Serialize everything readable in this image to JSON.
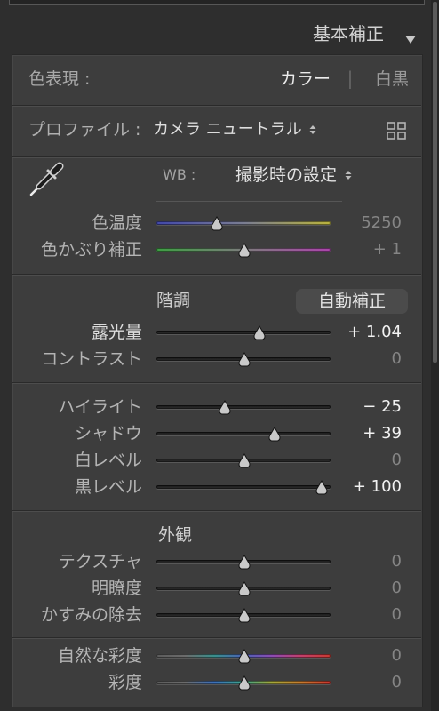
{
  "panel": {
    "title": "基本補正"
  },
  "icons": {
    "collapse": "collapse-triangle-icon",
    "eyedropper": "eyedropper-icon",
    "dropdown": "updown-arrows-icon",
    "profile_browser": "grid-icon"
  },
  "treatment": {
    "label": "色表現 :",
    "options": [
      {
        "label": "カラー",
        "selected": true
      },
      {
        "label": "白黒",
        "selected": false
      }
    ],
    "separator": "|"
  },
  "profile": {
    "label": "プロファイル :",
    "value": "カメラ ニュートラル"
  },
  "white_balance": {
    "label": "WB :",
    "value": "撮影時の設定",
    "sliders": [
      {
        "label": "色温度",
        "value": "5250",
        "level": 0.32,
        "track_colors": [
          "#4248aa",
          "#7a7d92",
          "#bab33e"
        ]
      },
      {
        "label": "色かぶり補正",
        "value": "+ 1",
        "level": 0.5,
        "track_colors": [
          "#3f9e44",
          "#7c7c7c",
          "#ab45ab"
        ]
      }
    ]
  },
  "tone": {
    "heading": "階調",
    "auto_button": "自動補正",
    "sliders": [
      {
        "label": "露光量",
        "value": "+ 1.04",
        "level": 0.6
      },
      {
        "label": "コントラスト",
        "value": "0",
        "level": 0.5
      },
      {
        "label": "ハイライト",
        "value": "− 25",
        "level": 0.375
      },
      {
        "label": "シャドウ",
        "value": "+ 39",
        "level": 0.695
      },
      {
        "label": "白レベル",
        "value": "0",
        "level": 0.5
      },
      {
        "label": "黒レベル",
        "value": "+ 100",
        "level": 1.0
      }
    ]
  },
  "presence": {
    "heading": "外観",
    "sliders": [
      {
        "label": "テクスチャ",
        "value": "0",
        "level": 0.5
      },
      {
        "label": "明瞭度",
        "value": "0",
        "level": 0.5
      },
      {
        "label": "かすみの除去",
        "value": "0",
        "level": 0.5
      },
      {
        "label": "自然な彩度",
        "value": "0",
        "level": 0.5,
        "track_colors": [
          "#5c5c5c",
          "#6c6c6c",
          "#3a8f8c",
          "#4b62b4",
          "#8c4cb2",
          "#c3406a",
          "#c83a32"
        ]
      },
      {
        "label": "彩度",
        "value": "0",
        "level": 0.5,
        "track_colors": [
          "#5c5c5c",
          "#6c6c6c",
          "#3c6fba",
          "#3ea38a",
          "#a6a83a",
          "#c77a2e",
          "#c9352f"
        ]
      }
    ]
  }
}
